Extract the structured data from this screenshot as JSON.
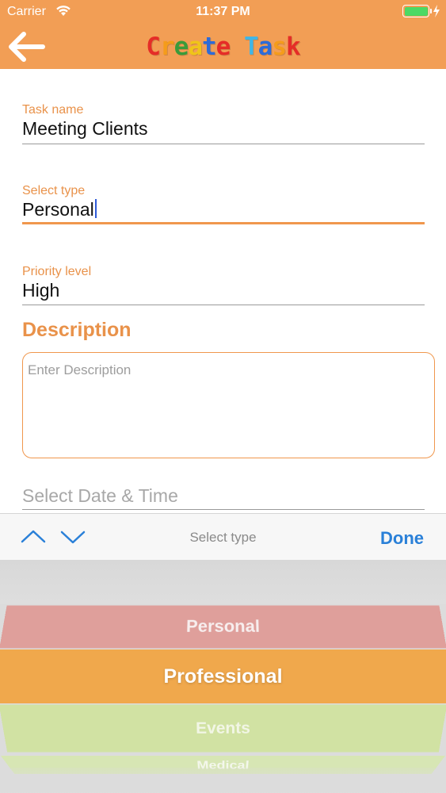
{
  "status_bar": {
    "carrier": "Carrier",
    "time": "11:37 PM",
    "battery_color": "#4cd964"
  },
  "nav": {
    "back_icon": "arrow-left-icon",
    "title": "Create Task",
    "title_colors": [
      "#e52d27",
      "#f59c1a",
      "#3a9b3a",
      "#f0c419",
      "#2d6bd8",
      "#e52d27",
      "#3fb6e8",
      "#2d6bd8",
      "#f59c1a",
      "#e52d27",
      "#2d6bd8"
    ],
    "bar_color": "#f29e55"
  },
  "form": {
    "task_name": {
      "label": "Task name",
      "value": "Meeting Clients"
    },
    "select_type": {
      "label": "Select type",
      "value": "Personal"
    },
    "priority": {
      "label": "Priority level",
      "value": "High"
    },
    "description": {
      "title": "Description",
      "placeholder": "Enter Description"
    },
    "date_time": {
      "placeholder": "Select Date & Time"
    },
    "accent_color": "#f0974d"
  },
  "toolbar": {
    "up_icon": "chevron-up-icon",
    "down_icon": "chevron-down-icon",
    "title": "Select type",
    "done_label": "Done"
  },
  "picker": {
    "options": [
      "Personal",
      "Professional",
      "Events",
      "Medical"
    ],
    "selected": "Professional",
    "option_colors": [
      "#df9f9b",
      "#f0a84c",
      "#d1e2a3",
      "#d7e6b4"
    ]
  }
}
